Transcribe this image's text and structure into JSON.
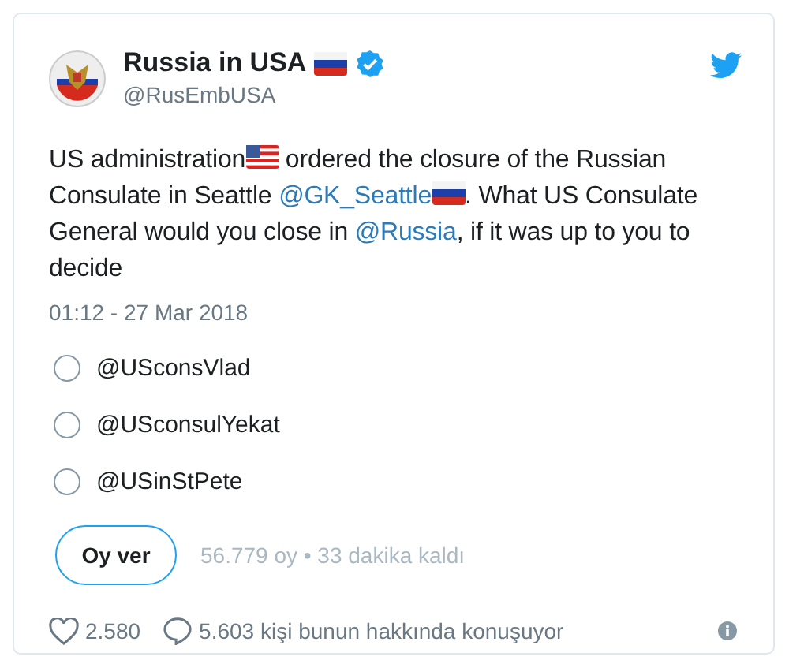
{
  "author": {
    "name": [
      {
        "kind": "text",
        "text": "Russia in USA"
      },
      {
        "kind": "ruflag"
      }
    ],
    "verified": true,
    "handle": "@RusEmbUSA"
  },
  "text": [
    {
      "kind": "text",
      "text": "US administration"
    },
    {
      "kind": "usflag"
    },
    {
      "kind": "text",
      "text": " ordered the closure of the Russian Consulate in Seattle "
    },
    {
      "kind": "mention",
      "text": "@GK_Seattle"
    },
    {
      "kind": "ruflag"
    },
    {
      "kind": "text",
      "text": ". What US Consulate General would you close in "
    },
    {
      "kind": "mention",
      "text": "@Russia"
    },
    {
      "kind": "text",
      "text": ", if it was up to you to decide"
    }
  ],
  "timestamp": "01:12 - 27 Mar 2018",
  "poll": {
    "options": [
      {
        "label": "@USconsVlad",
        "selected": false
      },
      {
        "label": "@USconsulYekat",
        "selected": false
      },
      {
        "label": "@USinStPete",
        "selected": false
      }
    ],
    "vote_button": "Oy ver",
    "summary": "56.779 oy • 33 dakika kaldı"
  },
  "footer": {
    "likes": "2.580",
    "conversation": "5.603 kişi bunun hakkında konuşuyor"
  }
}
